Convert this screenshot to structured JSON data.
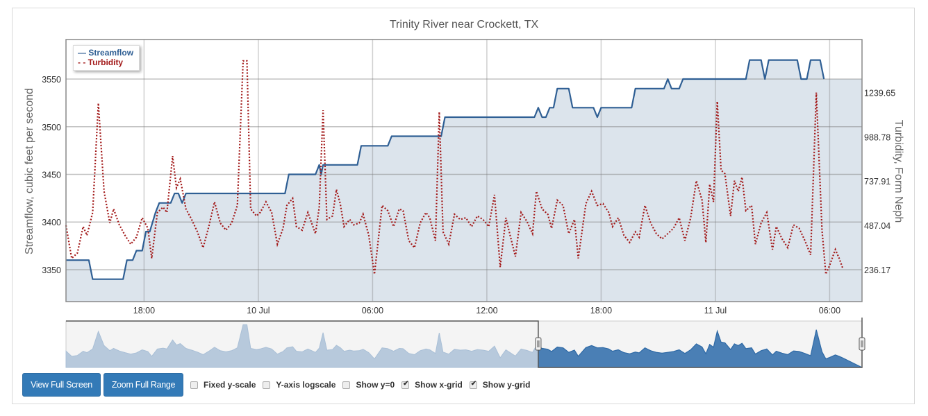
{
  "chart_data": {
    "type": "line",
    "title": "Trinity River near Crockett, TX",
    "xlabel": "",
    "ylabel": "Streamflow, cubic feet per second",
    "y2label": "Turbidity, Form Neph",
    "x_unit": "hours since 9 Jul 00:00",
    "xlim": [
      13.9,
      55.7
    ],
    "ylim": [
      3316.5,
      3591.5
    ],
    "y2lim": [
      54.5,
      1541.0
    ],
    "x_ticks": [
      {
        "x": 18,
        "label": "18:00"
      },
      {
        "x": 24,
        "label": "10 Jul"
      },
      {
        "x": 30,
        "label": "06:00"
      },
      {
        "x": 36,
        "label": "12:00"
      },
      {
        "x": 42,
        "label": "18:00"
      },
      {
        "x": 48,
        "label": "11 Jul"
      },
      {
        "x": 54,
        "label": "06:00"
      }
    ],
    "y_ticks": [
      3350,
      3400,
      3450,
      3500,
      3550
    ],
    "y2_ticks": [
      236.17,
      487.04,
      737.91,
      988.78,
      1239.65
    ],
    "grid": true,
    "legend": "top-left",
    "series": [
      {
        "name": "Streamflow",
        "axis": "left",
        "style": "solid-area",
        "color": "#2f5f94",
        "fill": "#dce4ec",
        "points": [
          [
            13.9,
            3360
          ],
          [
            15.1,
            3360
          ],
          [
            15.3,
            3340
          ],
          [
            16.9,
            3340
          ],
          [
            17.1,
            3360
          ],
          [
            17.4,
            3360
          ],
          [
            17.6,
            3370
          ],
          [
            17.9,
            3370
          ],
          [
            18.1,
            3390
          ],
          [
            18.3,
            3390
          ],
          [
            18.6,
            3410
          ],
          [
            18.8,
            3420
          ],
          [
            19.4,
            3420
          ],
          [
            19.6,
            3430
          ],
          [
            19.8,
            3430
          ],
          [
            20.0,
            3420
          ],
          [
            20.2,
            3430
          ],
          [
            25.4,
            3430
          ],
          [
            25.6,
            3450
          ],
          [
            27.0,
            3450
          ],
          [
            27.2,
            3460
          ],
          [
            27.3,
            3450
          ],
          [
            27.4,
            3460
          ],
          [
            29.2,
            3460
          ],
          [
            29.4,
            3480
          ],
          [
            30.8,
            3480
          ],
          [
            31.0,
            3490
          ],
          [
            33.6,
            3490
          ],
          [
            33.8,
            3510
          ],
          [
            38.5,
            3510
          ],
          [
            38.7,
            3520
          ],
          [
            38.9,
            3510
          ],
          [
            39.1,
            3510
          ],
          [
            39.3,
            3520
          ],
          [
            39.5,
            3520
          ],
          [
            39.7,
            3540
          ],
          [
            40.3,
            3540
          ],
          [
            40.5,
            3520
          ],
          [
            41.6,
            3520
          ],
          [
            41.8,
            3510
          ],
          [
            42.0,
            3520
          ],
          [
            43.6,
            3520
          ],
          [
            43.8,
            3540
          ],
          [
            45.3,
            3540
          ],
          [
            45.5,
            3550
          ],
          [
            45.7,
            3540
          ],
          [
            46.1,
            3540
          ],
          [
            46.3,
            3550
          ],
          [
            49.6,
            3550
          ],
          [
            49.8,
            3570
          ],
          [
            50.4,
            3570
          ],
          [
            50.6,
            3550
          ],
          [
            50.8,
            3570
          ],
          [
            52.3,
            3570
          ],
          [
            52.5,
            3550
          ],
          [
            52.8,
            3550
          ],
          [
            53.0,
            3570
          ],
          [
            53.5,
            3570
          ],
          [
            53.7,
            3550
          ]
        ]
      },
      {
        "name": "Turbidity",
        "axis": "right",
        "style": "dotted",
        "color": "#a31a1a",
        "points": [
          [
            13.9,
            487
          ],
          [
            14.2,
            300
          ],
          [
            14.5,
            330
          ],
          [
            14.8,
            480
          ],
          [
            15.0,
            430
          ],
          [
            15.3,
            560
          ],
          [
            15.6,
            1180
          ],
          [
            15.9,
            680
          ],
          [
            16.2,
            500
          ],
          [
            16.4,
            580
          ],
          [
            16.7,
            490
          ],
          [
            17.0,
            430
          ],
          [
            17.3,
            380
          ],
          [
            17.6,
            420
          ],
          [
            17.9,
            530
          ],
          [
            18.2,
            470
          ],
          [
            18.4,
            300
          ],
          [
            18.7,
            560
          ],
          [
            19.0,
            590
          ],
          [
            19.2,
            560
          ],
          [
            19.5,
            880
          ],
          [
            19.7,
            700
          ],
          [
            19.9,
            750
          ],
          [
            20.2,
            580
          ],
          [
            20.5,
            520
          ],
          [
            20.8,
            450
          ],
          [
            21.1,
            360
          ],
          [
            21.4,
            480
          ],
          [
            21.7,
            620
          ],
          [
            22.0,
            500
          ],
          [
            22.3,
            460
          ],
          [
            22.6,
            500
          ],
          [
            22.9,
            600
          ],
          [
            23.2,
            1420
          ],
          [
            23.4,
            1420
          ],
          [
            23.6,
            580
          ],
          [
            23.9,
            540
          ],
          [
            24.1,
            560
          ],
          [
            24.4,
            620
          ],
          [
            24.7,
            560
          ],
          [
            25.0,
            380
          ],
          [
            25.3,
            470
          ],
          [
            25.5,
            600
          ],
          [
            25.8,
            640
          ],
          [
            26.0,
            480
          ],
          [
            26.3,
            460
          ],
          [
            26.6,
            560
          ],
          [
            27.0,
            440
          ],
          [
            27.2,
            590
          ],
          [
            27.4,
            1140
          ],
          [
            27.6,
            520
          ],
          [
            27.9,
            540
          ],
          [
            28.1,
            690
          ],
          [
            28.3,
            610
          ],
          [
            28.5,
            480
          ],
          [
            28.8,
            520
          ],
          [
            29.0,
            490
          ],
          [
            29.3,
            500
          ],
          [
            29.5,
            550
          ],
          [
            29.8,
            430
          ],
          [
            30.1,
            210
          ],
          [
            30.5,
            600
          ],
          [
            30.8,
            570
          ],
          [
            31.1,
            480
          ],
          [
            31.4,
            580
          ],
          [
            31.6,
            570
          ],
          [
            31.9,
            400
          ],
          [
            32.2,
            360
          ],
          [
            32.5,
            500
          ],
          [
            32.8,
            560
          ],
          [
            33.0,
            530
          ],
          [
            33.3,
            400
          ],
          [
            33.5,
            1130
          ],
          [
            33.7,
            450
          ],
          [
            34.0,
            380
          ],
          [
            34.3,
            550
          ],
          [
            34.6,
            520
          ],
          [
            34.9,
            530
          ],
          [
            35.2,
            480
          ],
          [
            35.5,
            540
          ],
          [
            35.8,
            520
          ],
          [
            36.1,
            480
          ],
          [
            36.4,
            660
          ],
          [
            36.7,
            250
          ],
          [
            37.0,
            530
          ],
          [
            37.2,
            440
          ],
          [
            37.5,
            310
          ],
          [
            37.8,
            560
          ],
          [
            38.1,
            510
          ],
          [
            38.4,
            440
          ],
          [
            38.6,
            680
          ],
          [
            38.9,
            580
          ],
          [
            39.2,
            550
          ],
          [
            39.4,
            470
          ],
          [
            39.7,
            630
          ],
          [
            40.0,
            600
          ],
          [
            40.3,
            440
          ],
          [
            40.6,
            520
          ],
          [
            40.8,
            300
          ],
          [
            41.2,
            610
          ],
          [
            41.5,
            680
          ],
          [
            41.8,
            600
          ],
          [
            42.1,
            610
          ],
          [
            42.4,
            560
          ],
          [
            42.6,
            480
          ],
          [
            42.9,
            530
          ],
          [
            43.2,
            430
          ],
          [
            43.5,
            390
          ],
          [
            43.8,
            450
          ],
          [
            44.0,
            420
          ],
          [
            44.3,
            600
          ],
          [
            44.6,
            500
          ],
          [
            44.9,
            440
          ],
          [
            45.2,
            410
          ],
          [
            45.5,
            440
          ],
          [
            45.8,
            470
          ],
          [
            46.1,
            530
          ],
          [
            46.4,
            400
          ],
          [
            46.7,
            530
          ],
          [
            47.0,
            740
          ],
          [
            47.3,
            630
          ],
          [
            47.5,
            390
          ],
          [
            47.7,
            720
          ],
          [
            47.9,
            620
          ],
          [
            48.1,
            1190
          ],
          [
            48.3,
            800
          ],
          [
            48.5,
            780
          ],
          [
            48.8,
            540
          ],
          [
            49.0,
            740
          ],
          [
            49.2,
            680
          ],
          [
            49.4,
            760
          ],
          [
            49.6,
            570
          ],
          [
            49.9,
            600
          ],
          [
            50.1,
            380
          ],
          [
            50.4,
            500
          ],
          [
            50.7,
            560
          ],
          [
            51.0,
            350
          ],
          [
            51.2,
            480
          ],
          [
            51.5,
            410
          ],
          [
            51.8,
            360
          ],
          [
            52.1,
            490
          ],
          [
            52.4,
            470
          ],
          [
            52.7,
            400
          ],
          [
            53.0,
            320
          ],
          [
            53.3,
            1240
          ],
          [
            53.6,
            460
          ],
          [
            53.8,
            210
          ],
          [
            54.0,
            260
          ],
          [
            54.3,
            350
          ],
          [
            54.5,
            300
          ],
          [
            54.7,
            240
          ]
        ]
      }
    ],
    "navigator": {
      "range_start": 38.7,
      "range_end": 55.7,
      "full_start": 13.9,
      "full_end": 55.7
    }
  },
  "legend": {
    "streamflow_label": "Streamflow",
    "turbidity_label": "Turbidity",
    "streamflow_symbol": "—",
    "turbidity_symbol": "- -"
  },
  "controls": {
    "view_full_screen": "View Full Screen",
    "zoom_full_range": "Zoom Full Range",
    "checkboxes": [
      {
        "label": "Fixed y-scale",
        "checked": false
      },
      {
        "label": "Y-axis logscale",
        "checked": false
      },
      {
        "label": "Show y=0",
        "checked": false
      },
      {
        "label": "Show x-grid",
        "checked": true
      },
      {
        "label": "Show y-grid",
        "checked": true
      }
    ]
  }
}
